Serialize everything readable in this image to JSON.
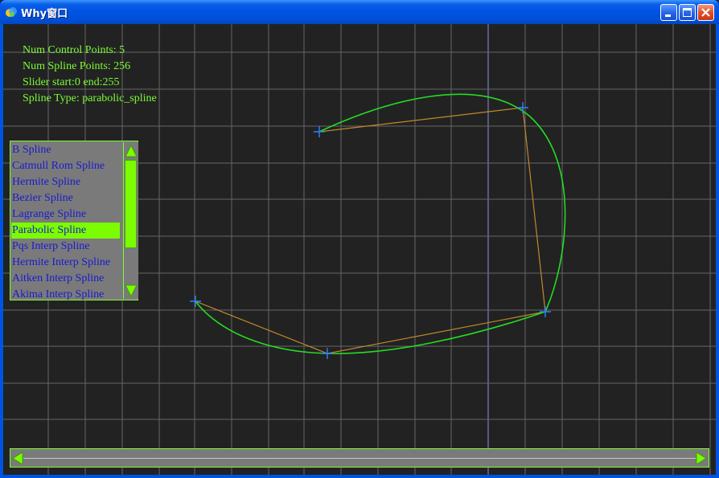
{
  "window": {
    "title": "Why窗口"
  },
  "info": {
    "num_control_points": "Num Control Points: 5",
    "num_spline_points": "Num Spline Points: 256",
    "slider": "Slider start:0 end:255",
    "spline_type": "Spline Type: parabolic_spline"
  },
  "list": {
    "items": [
      "B Spline",
      "Catmull Rom Spline",
      "Hermite Spline",
      "Bezier Spline",
      "Lagrange Spline",
      "Parabolic Spline",
      "Pqs Interp Spline",
      "Hermite Interp Spline",
      "Aitken Interp Spline",
      "Akima Interp Spline"
    ],
    "selected": "Parabolic Spline"
  },
  "slider": {
    "start": 0,
    "end": 255
  },
  "colors": {
    "background": "#222222",
    "grid": "#666666",
    "highlight_grid": "#8e8ed8",
    "text": "#7cfc34",
    "curve": "#22dd22",
    "control_polygon": "#c08a2a",
    "control_point": "#2f80ff",
    "list_selected": "#7cfc00",
    "list_text": "#1a1ad0",
    "panel": "#7a7a7a"
  }
}
